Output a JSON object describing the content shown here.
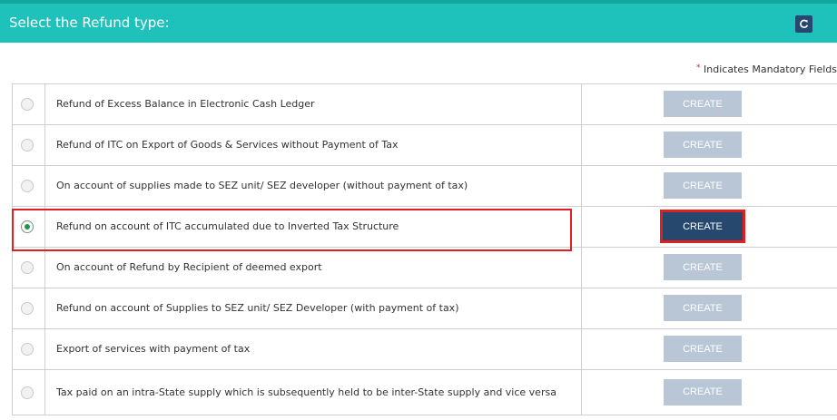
{
  "header": {
    "title": "Select the Refund type:",
    "refresh_icon": "refresh-icon"
  },
  "mandatory_note": {
    "star": "*",
    "text": "Indicates Mandatory Fields"
  },
  "colors": {
    "header_bg": "#1fc2ba",
    "active_button": "#26486e",
    "disabled_button": "#b8c6d6",
    "highlight": "#e02020",
    "selected_radio": "#1a9a45"
  },
  "refund_types": [
    {
      "label": "Refund of Excess Balance in Electronic Cash Ledger",
      "button": "CREATE",
      "selected": false
    },
    {
      "label": "Refund of ITC on Export of Goods & Services without Payment of Tax",
      "button": "CREATE",
      "selected": false
    },
    {
      "label": "On account of supplies made to SEZ unit/ SEZ developer (without payment of tax)",
      "button": "CREATE",
      "selected": false
    },
    {
      "label": "Refund on account of ITC accumulated due to Inverted Tax Structure",
      "button": "CREATE",
      "selected": true
    },
    {
      "label": "On account of Refund by Recipient of deemed export",
      "button": "CREATE",
      "selected": false
    },
    {
      "label": "Refund on account of Supplies to SEZ unit/ SEZ Developer (with payment of tax)",
      "button": "CREATE",
      "selected": false
    },
    {
      "label": "Export of services with payment of tax",
      "button": "CREATE",
      "selected": false
    },
    {
      "label": "Tax paid on an intra-State supply which is subsequently held to be inter-State supply and vice versa",
      "button": "CREATE",
      "selected": false
    }
  ]
}
